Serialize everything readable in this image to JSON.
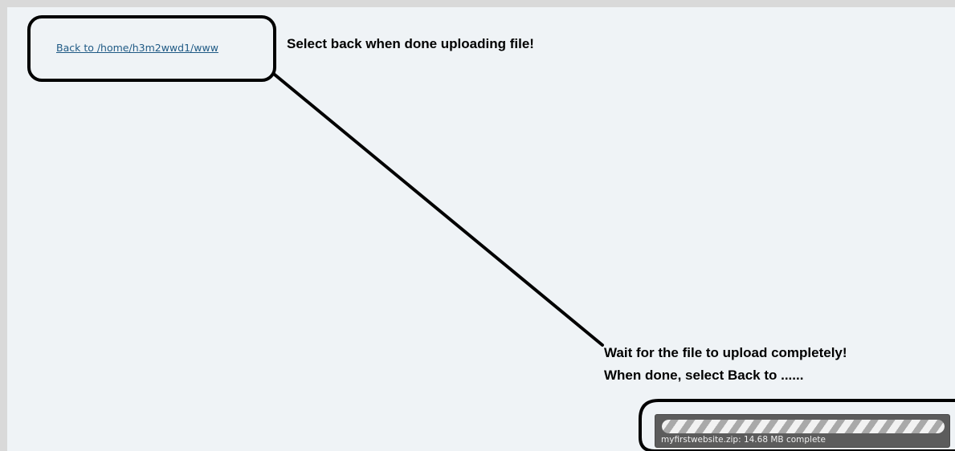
{
  "navigation": {
    "back_link_label": "Back to /home/h3m2wwd1/www"
  },
  "annotations": {
    "back_hint": "Select back when done uploading file!",
    "wait_line_1": "Wait for the file to upload completely!",
    "wait_line_2": "When done, select Back to ......"
  },
  "upload": {
    "status_text": "myfirstwebsite.zip: 14.68 MB complete",
    "progress_fraction": 1.0
  },
  "colors": {
    "panel_background": "#eff3f6",
    "link": "#1f5a85",
    "progress_background": "#5c5c5c"
  }
}
